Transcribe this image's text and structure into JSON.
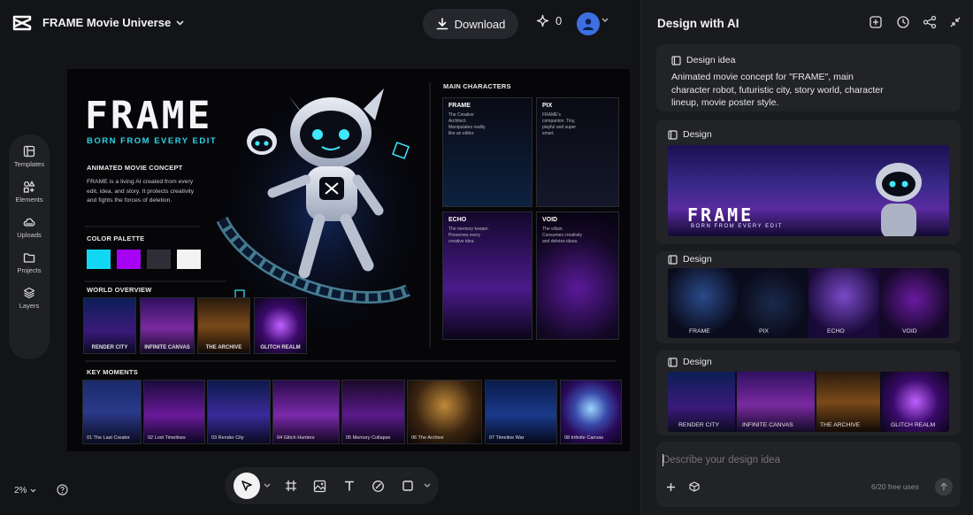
{
  "app": {
    "project_title": "FRAME Movie Universe"
  },
  "header": {
    "download_label": "Download",
    "credits": "0"
  },
  "tools": [
    {
      "label": "Templates",
      "icon": "templates-icon"
    },
    {
      "label": "Elements",
      "icon": "elements-icon"
    },
    {
      "label": "Uploads",
      "icon": "uploads-icon"
    },
    {
      "label": "Projects",
      "icon": "projects-icon"
    },
    {
      "label": "Layers",
      "icon": "layers-icon"
    }
  ],
  "canvas": {
    "title": "FRAME",
    "tagline": "BORN FROM EVERY EDIT",
    "concept_heading": "ANIMATED MOVIE CONCEPT",
    "concept_text": "FRAME is a living AI created from every edit, idea, and story. It protects creativity and fights the forces of deletion.",
    "palette_heading": "COLOR PALETTE",
    "palette": [
      "#11d8f2",
      "#a600f5",
      "#2e2f36",
      "#f3f3f3"
    ],
    "world_heading": "WORLD OVERVIEW",
    "worlds": [
      "RENDER CITY",
      "INFINITE CANVAS",
      "THE ARCHIVE",
      "GLITCH REALM"
    ],
    "characters_heading": "MAIN CHARACTERS",
    "characters": [
      {
        "name": "FRAME",
        "desc": "The Creative Architect. Manipulates reality like an editor."
      },
      {
        "name": "PIX",
        "desc": "FRAME's companion. Tiny, playful and super smart."
      },
      {
        "name": "ECHO",
        "desc": "The memory keeper. Preserves every creative idea."
      },
      {
        "name": "VOID",
        "desc": "The villain. Consumes creativity and deletes ideas."
      }
    ],
    "moments_heading": "KEY MOMENTS",
    "moments": [
      "01 The Last Creator",
      "02 Lost Timelines",
      "03 Render City",
      "04 Glitch Hunters",
      "05 Memory Collapse",
      "06 The Archive",
      "07 Timeline War",
      "08 Infinite Canvas"
    ]
  },
  "footer": {
    "zoom": "2%"
  },
  "panel": {
    "title": "Design with AI",
    "idea_label": "Design idea",
    "idea_text": "Animated movie concept for \"FRAME\", main character robot, futuristic city, story world, character lineup, movie poster style.",
    "design_label": "Design",
    "poster_title": "FRAME",
    "poster_tagline": "BORN FROM EVERY EDIT",
    "lineup": [
      "FRAME",
      "PIX",
      "ECHO",
      "VOID"
    ],
    "world_strip": [
      "RENDER CITY",
      "INFINITE CANVAS",
      "THE ARCHIVE",
      "GLITCH REALM"
    ],
    "input_placeholder": "Describe your design idea",
    "free_uses": "6/20 free uses"
  },
  "colors": {
    "accent_cyan": "#2fd3ea",
    "accent_purple": "#a600f5",
    "panel_bg": "#1a1b1f",
    "user_avatar": "#3d6fe0"
  }
}
